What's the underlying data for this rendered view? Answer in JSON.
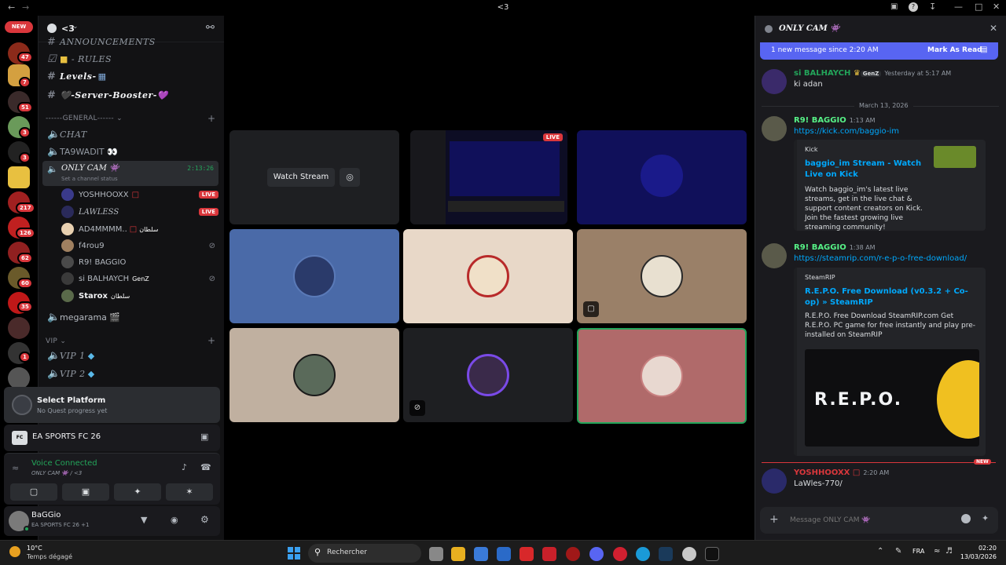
{
  "window": {
    "title": "<3"
  },
  "rail": {
    "new_label": "NEW",
    "badges": [
      "47",
      "7",
      "51",
      "3",
      "3",
      "217",
      "126",
      "62",
      "60",
      "35",
      "1"
    ]
  },
  "server": {
    "name": "<3"
  },
  "channels": {
    "announcements": "ANNOUNCEMENTS",
    "rules": "- RULES",
    "levels": "Levels-",
    "booster": "🖤-Server-Booster-💜",
    "general_cat": "------GENERAL------",
    "chat": "CHAT",
    "ta9wadit": "TA9WADIT 👀",
    "only_cam": "ONLY CAM 👾",
    "only_cam_time": "2:13:26",
    "only_cam_status": "Set a channel status",
    "megarama": "megarama 🎬",
    "vip_cat": "VIP",
    "vip1": "VIP 1",
    "vip2": "VIP 2"
  },
  "voice_users": [
    {
      "name": "YOSHHOOXX",
      "live": "LIVE"
    },
    {
      "name": "LAWLESS",
      "live": "LIVE"
    },
    {
      "name": "AD4MMMM..",
      "tag": "سلطان"
    },
    {
      "name": "f4rou9"
    },
    {
      "name": "R9! BAGGIO"
    },
    {
      "name": "si BALHAYCH",
      "tag": "GenZ"
    },
    {
      "name": "Starox",
      "tag": "سلطان"
    }
  ],
  "quest": {
    "title": "Select Platform",
    "sub": "No Quest progress yet"
  },
  "activity": {
    "game": "EA SPORTS FC 26"
  },
  "voice": {
    "status": "Voice Connected",
    "channel": "ONLY CAM 👾 / <3"
  },
  "user": {
    "name": "BaGGio",
    "activity": "EA SPORTS FC 26 +1"
  },
  "stage": {
    "watch_label": "Watch Stream",
    "live": "LIVE"
  },
  "chat": {
    "title": "ONLY CAM 👾",
    "new_banner": "1 new message since 2:20 AM",
    "mark_read": "Mark As Read",
    "date_divider": "March 13, 2026",
    "messages": [
      {
        "name": "si BALHAYCH",
        "tag": "GenZ",
        "time": "Yesterday at 5:17 AM",
        "text": "ki adan"
      },
      {
        "name": "R9! BAGGIO",
        "time": "1:13 AM",
        "text": "https://kick.com/baggio-im"
      },
      {
        "name": "R9! BAGGIO",
        "time": "1:38 AM",
        "text": "https://steamrip.com/r-e-p-o-free-download/"
      },
      {
        "name": "YOSHHOOXX",
        "time": "2:20 AM",
        "text": "LaWles-770/"
      }
    ],
    "embed1": {
      "provider": "Kick",
      "title": "baggio_im Stream - Watch Live on Kick",
      "desc": "Watch baggio_im's latest live streams, get in the live chat & support content creators on Kick. Join the fastest growing live streaming community!"
    },
    "embed2": {
      "provider": "SteamRIP",
      "title": "R.E.P.O. Free Download (v0.3.2 + Co-op) » SteamRIP",
      "desc": "R.E.P.O. Free Download SteamRIP.com Get R.E.P.O. PC game for free instantly and play pre-installed on SteamRIP",
      "image_text": "R.E.P.O."
    },
    "new_label": "NEW",
    "placeholder": "Message ONLY CAM 👾"
  },
  "taskbar": {
    "temp": "10°C",
    "weather": "Temps dégagé",
    "search": "Rechercher",
    "lang": "FRA",
    "time": "02:20",
    "date": "13/03/2026"
  }
}
